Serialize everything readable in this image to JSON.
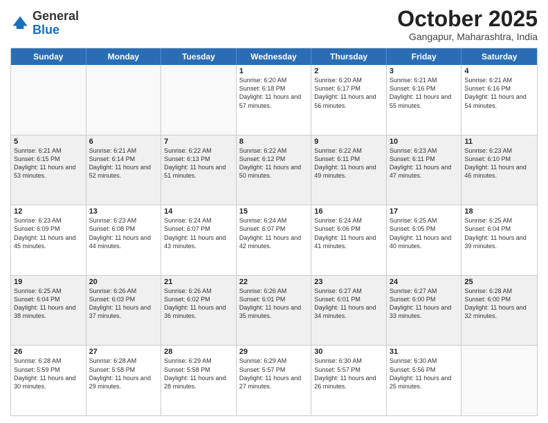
{
  "header": {
    "logo_general": "General",
    "logo_blue": "Blue",
    "month_title": "October 2025",
    "location": "Gangapur, Maharashtra, India"
  },
  "weekdays": [
    "Sunday",
    "Monday",
    "Tuesday",
    "Wednesday",
    "Thursday",
    "Friday",
    "Saturday"
  ],
  "rows": [
    [
      {
        "day": "",
        "empty": true
      },
      {
        "day": "",
        "empty": true
      },
      {
        "day": "",
        "empty": true
      },
      {
        "day": "1",
        "sunrise": "Sunrise: 6:20 AM",
        "sunset": "Sunset: 6:18 PM",
        "daylight": "Daylight: 11 hours and 57 minutes."
      },
      {
        "day": "2",
        "sunrise": "Sunrise: 6:20 AM",
        "sunset": "Sunset: 6:17 PM",
        "daylight": "Daylight: 11 hours and 56 minutes."
      },
      {
        "day": "3",
        "sunrise": "Sunrise: 6:21 AM",
        "sunset": "Sunset: 6:16 PM",
        "daylight": "Daylight: 11 hours and 55 minutes."
      },
      {
        "day": "4",
        "sunrise": "Sunrise: 6:21 AM",
        "sunset": "Sunset: 6:16 PM",
        "daylight": "Daylight: 11 hours and 54 minutes."
      }
    ],
    [
      {
        "day": "5",
        "sunrise": "Sunrise: 6:21 AM",
        "sunset": "Sunset: 6:15 PM",
        "daylight": "Daylight: 11 hours and 53 minutes."
      },
      {
        "day": "6",
        "sunrise": "Sunrise: 6:21 AM",
        "sunset": "Sunset: 6:14 PM",
        "daylight": "Daylight: 11 hours and 52 minutes."
      },
      {
        "day": "7",
        "sunrise": "Sunrise: 6:22 AM",
        "sunset": "Sunset: 6:13 PM",
        "daylight": "Daylight: 11 hours and 51 minutes."
      },
      {
        "day": "8",
        "sunrise": "Sunrise: 6:22 AM",
        "sunset": "Sunset: 6:12 PM",
        "daylight": "Daylight: 11 hours and 50 minutes."
      },
      {
        "day": "9",
        "sunrise": "Sunrise: 6:22 AM",
        "sunset": "Sunset: 6:11 PM",
        "daylight": "Daylight: 11 hours and 49 minutes."
      },
      {
        "day": "10",
        "sunrise": "Sunrise: 6:23 AM",
        "sunset": "Sunset: 6:11 PM",
        "daylight": "Daylight: 11 hours and 47 minutes."
      },
      {
        "day": "11",
        "sunrise": "Sunrise: 6:23 AM",
        "sunset": "Sunset: 6:10 PM",
        "daylight": "Daylight: 11 hours and 46 minutes."
      }
    ],
    [
      {
        "day": "12",
        "sunrise": "Sunrise: 6:23 AM",
        "sunset": "Sunset: 6:09 PM",
        "daylight": "Daylight: 11 hours and 45 minutes."
      },
      {
        "day": "13",
        "sunrise": "Sunrise: 6:23 AM",
        "sunset": "Sunset: 6:08 PM",
        "daylight": "Daylight: 11 hours and 44 minutes."
      },
      {
        "day": "14",
        "sunrise": "Sunrise: 6:24 AM",
        "sunset": "Sunset: 6:07 PM",
        "daylight": "Daylight: 11 hours and 43 minutes."
      },
      {
        "day": "15",
        "sunrise": "Sunrise: 6:24 AM",
        "sunset": "Sunset: 6:07 PM",
        "daylight": "Daylight: 11 hours and 42 minutes."
      },
      {
        "day": "16",
        "sunrise": "Sunrise: 6:24 AM",
        "sunset": "Sunset: 6:06 PM",
        "daylight": "Daylight: 11 hours and 41 minutes."
      },
      {
        "day": "17",
        "sunrise": "Sunrise: 6:25 AM",
        "sunset": "Sunset: 6:05 PM",
        "daylight": "Daylight: 11 hours and 40 minutes."
      },
      {
        "day": "18",
        "sunrise": "Sunrise: 6:25 AM",
        "sunset": "Sunset: 6:04 PM",
        "daylight": "Daylight: 11 hours and 39 minutes."
      }
    ],
    [
      {
        "day": "19",
        "sunrise": "Sunrise: 6:25 AM",
        "sunset": "Sunset: 6:04 PM",
        "daylight": "Daylight: 11 hours and 38 minutes."
      },
      {
        "day": "20",
        "sunrise": "Sunrise: 6:26 AM",
        "sunset": "Sunset: 6:03 PM",
        "daylight": "Daylight: 11 hours and 37 minutes."
      },
      {
        "day": "21",
        "sunrise": "Sunrise: 6:26 AM",
        "sunset": "Sunset: 6:02 PM",
        "daylight": "Daylight: 11 hours and 36 minutes."
      },
      {
        "day": "22",
        "sunrise": "Sunrise: 6:26 AM",
        "sunset": "Sunset: 6:01 PM",
        "daylight": "Daylight: 11 hours and 35 minutes."
      },
      {
        "day": "23",
        "sunrise": "Sunrise: 6:27 AM",
        "sunset": "Sunset: 6:01 PM",
        "daylight": "Daylight: 11 hours and 34 minutes."
      },
      {
        "day": "24",
        "sunrise": "Sunrise: 6:27 AM",
        "sunset": "Sunset: 6:00 PM",
        "daylight": "Daylight: 11 hours and 33 minutes."
      },
      {
        "day": "25",
        "sunrise": "Sunrise: 6:28 AM",
        "sunset": "Sunset: 6:00 PM",
        "daylight": "Daylight: 11 hours and 32 minutes."
      }
    ],
    [
      {
        "day": "26",
        "sunrise": "Sunrise: 6:28 AM",
        "sunset": "Sunset: 5:59 PM",
        "daylight": "Daylight: 11 hours and 30 minutes."
      },
      {
        "day": "27",
        "sunrise": "Sunrise: 6:28 AM",
        "sunset": "Sunset: 5:58 PM",
        "daylight": "Daylight: 11 hours and 29 minutes."
      },
      {
        "day": "28",
        "sunrise": "Sunrise: 6:29 AM",
        "sunset": "Sunset: 5:58 PM",
        "daylight": "Daylight: 11 hours and 28 minutes."
      },
      {
        "day": "29",
        "sunrise": "Sunrise: 6:29 AM",
        "sunset": "Sunset: 5:57 PM",
        "daylight": "Daylight: 11 hours and 27 minutes."
      },
      {
        "day": "30",
        "sunrise": "Sunrise: 6:30 AM",
        "sunset": "Sunset: 5:57 PM",
        "daylight": "Daylight: 11 hours and 26 minutes."
      },
      {
        "day": "31",
        "sunrise": "Sunrise: 6:30 AM",
        "sunset": "Sunset: 5:56 PM",
        "daylight": "Daylight: 11 hours and 25 minutes."
      },
      {
        "day": "",
        "empty": true
      }
    ]
  ]
}
